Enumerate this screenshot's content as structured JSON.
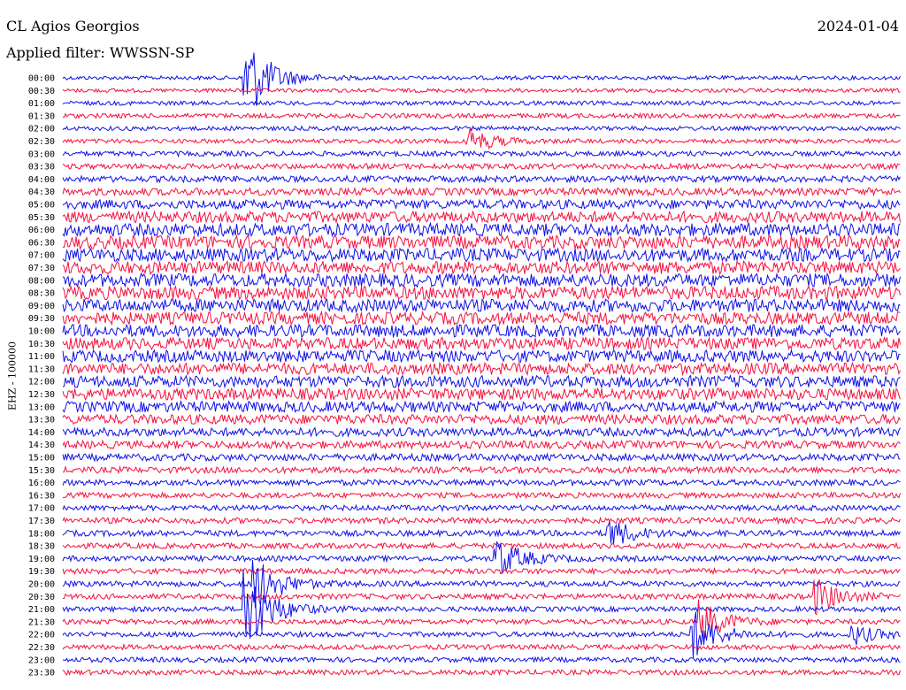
{
  "header": {
    "station": "CL Agios Georgios",
    "date": "2024-01-04",
    "filter": "Applied filter: WWSSN-SP"
  },
  "chart_data": {
    "type": "line",
    "title": "CL Agios Georgios",
    "ylabel": "EHZ - 100000",
    "row_labels": [
      "00:00",
      "00:30",
      "01:00",
      "01:30",
      "02:00",
      "02:30",
      "03:00",
      "03:30",
      "04:00",
      "04:30",
      "05:00",
      "05:30",
      "06:00",
      "06:30",
      "07:00",
      "07:30",
      "08:00",
      "08:30",
      "09:00",
      "09:30",
      "10:00",
      "10:30",
      "11:00",
      "11:30",
      "12:00",
      "12:30",
      "13:00",
      "13:30",
      "14:00",
      "14:30",
      "15:00",
      "15:30",
      "16:00",
      "16:30",
      "17:00",
      "17:30",
      "18:00",
      "18:30",
      "19:00",
      "19:30",
      "20:00",
      "20:30",
      "21:00",
      "21:30",
      "22:00",
      "22:30",
      "23:00",
      "23:30"
    ],
    "row_colors": [
      "#1010e8",
      "#f5103f"
    ],
    "noise_level": [
      1.0,
      1.0,
      1.1,
      1.2,
      1.1,
      1.1,
      1.3,
      1.4,
      1.6,
      1.9,
      2.4,
      2.9,
      3.3,
      3.4,
      3.4,
      3.3,
      3.4,
      3.4,
      3.3,
      3.2,
      3.2,
      3.1,
      3.1,
      3.0,
      3.0,
      3.0,
      2.8,
      2.5,
      2.2,
      2.0,
      1.8,
      1.6,
      1.5,
      1.4,
      1.4,
      1.5,
      1.5,
      1.4,
      1.4,
      1.4,
      1.4,
      1.4,
      1.3,
      1.3,
      1.3,
      1.3,
      1.3,
      1.3
    ],
    "events": [
      {
        "row": 0,
        "minute": 6.5,
        "amp": 9
      },
      {
        "row": 40,
        "minute": 6.8,
        "amp": 6
      },
      {
        "row": 42,
        "minute": 6.5,
        "amp": 9
      },
      {
        "row": 44,
        "minute": 22.5,
        "amp": 5
      },
      {
        "row": 38,
        "minute": 15.5,
        "amp": 4
      },
      {
        "row": 41,
        "minute": 26.8,
        "amp": 4
      },
      {
        "row": 43,
        "minute": 22.8,
        "amp": 4
      },
      {
        "row": 36,
        "minute": 19.5,
        "amp": 3
      },
      {
        "row": 5,
        "minute": 14.5,
        "amp": 2.5
      },
      {
        "row": 44,
        "minute": 28.2,
        "amp": 2
      }
    ]
  }
}
